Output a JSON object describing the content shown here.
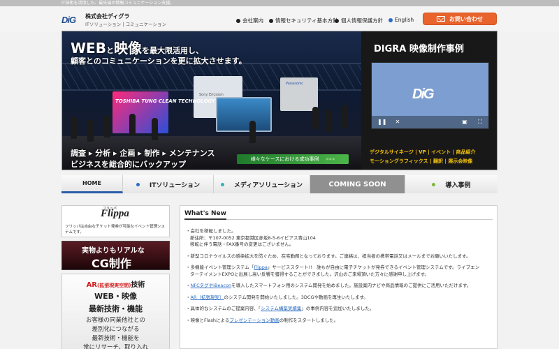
{
  "topbar": {
    "text": "IT技術を活用した、最先端の情報コミュニケーション支援。"
  },
  "header": {
    "logo": "DiG",
    "company_name": "株式会社ディグラ",
    "company_sub": "ITソリューション | コミュニケーション",
    "nav": [
      {
        "label": "会社案内"
      },
      {
        "label": "情報セキュリティ基本方針"
      },
      {
        "label": "個人情報保護方針"
      },
      {
        "label": "English"
      }
    ],
    "contact_label": "お問い合わせ"
  },
  "hero": {
    "headline_a": "WEB",
    "headline_b": "と",
    "headline_c": "映像",
    "headline_d": "を最大限活用し、",
    "headline2": "顧客とのコミュニケーションを更に拡大させます。",
    "booth1": "TOSHIBA TUNG CLEAN TECHNOLOGY",
    "booth2": "Sony Ericsson",
    "booth3": "Panasonic",
    "tagline1": "調査 ▸ 分析 ▸ 企画 ▸ 制作 ▸ メンテナンス",
    "tagline2": "ビジネスを総合的にバックアップ",
    "case_button": "様々なケースにおける成功事例",
    "case_arrows": "»»»",
    "right_title": "DIGRA 映像制作事例",
    "video_logo": "DiG",
    "tags1": "デジタルサイネージ | VP | イベント | 商品紹介",
    "tags2": "モーショングラフィックス | 翻訳 | 展示会映像"
  },
  "mainnav": {
    "tabs": [
      {
        "label": "HOME",
        "dot": ""
      },
      {
        "label": "ITソリューション",
        "dot": "#2b6cc4"
      },
      {
        "label": "メディアソリューション",
        "dot": "#2fb3b8"
      },
      {
        "label": "COMING SOON",
        "dot": "#a04a8a"
      },
      {
        "label": "導入事例",
        "dot": "#7ab83a"
      }
    ]
  },
  "sidebar": {
    "flippa_small": "フリッパ",
    "flippa_logo": "Flippa",
    "flippa_desc": "フリッパは自由なチケット発券が可能なイベント管理システムです。",
    "cg_line1": "実物よりもリアルな",
    "cg_line2": "CG制作",
    "ar_a": "AR",
    "ar_b": "(拡張現実空間)",
    "ar_c": "技術",
    "ar_line2": "WEB・映像",
    "ar_line3": "最新技術・機能",
    "ar_line4": "お客様の同業他社との",
    "ar_line5": "差別化につながる",
    "ar_line6": "最新技術・機能を",
    "ar_line7": "常にリサーチ、取り入れ"
  },
  "news": {
    "title": "What's New",
    "items": [
      {
        "lines": [
          "・会社を移転しました。",
          "新住所：〒107-0052 東京都港区赤坂8-5-6イビアス青山104",
          "移転に伴う電話・FAX番号の変更はございません。"
        ]
      },
      {
        "lines": [
          "・新型コロナウイルスの感染拡大を防ぐため、在宅勤務となっております。ご連絡は、担当者の携帯電話又はメールまでお願いいたします。"
        ]
      },
      {
        "pre": "・多機能イベント管理システム「",
        "link": "Flippa",
        "post": "」サービススタート!!　誰もが自由に電子チケットが発券できるイベント管理システムです。ライブエン",
        "line2": "ターテイメントEXPOに出展し高い反響を獲得することができました。沢山のご来場頂いた方々に感謝申し上げます。"
      },
      {
        "pre": "・",
        "link": "NFCタグやiBeacon",
        "post": "を導入したスマートフォン用のシステム開発を始めました。施設案内ナビや商品情報のご提供にご活用いただけます。"
      },
      {
        "pre": "・",
        "link": "AR（拡張現実）",
        "post": "のシステム開発を開始いたしました。3DCGや動画を再生いたします。"
      },
      {
        "pre": "・具体的なシステムのご提案内容、「",
        "link": "システム構築実績集",
        "post": "」の事例内容を追加いたしました。"
      },
      {
        "pre": "・映像とFlashによる",
        "link": "プレゼンテーション動画",
        "post": "の制作をスタートしました。"
      }
    ]
  }
}
